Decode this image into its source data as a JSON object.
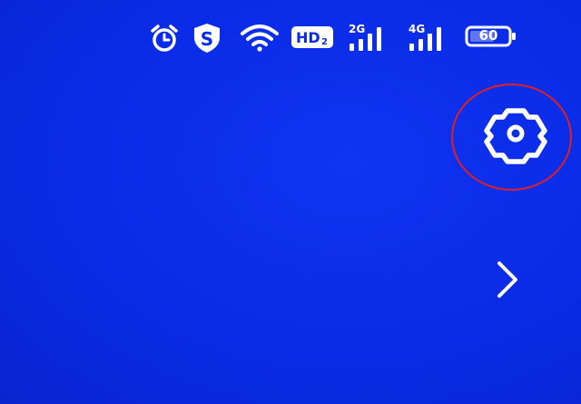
{
  "status_bar": {
    "icons": [
      "alarm-icon",
      "shield-s-icon",
      "wifi-icon",
      "hd-voice-icon",
      "signal-2g-icon",
      "signal-4g-icon",
      "battery-icon"
    ],
    "hd_label": "HD",
    "hd_sub": "2",
    "net1_label": "2G",
    "net2_label": "4G",
    "battery_level": "60"
  },
  "shield_letter": "S",
  "settings": {
    "icon": "gear-icon",
    "highlight_color": "#e02020"
  },
  "navigation": {
    "icon": "chevron-right-icon"
  },
  "colors": {
    "background": "#0a2be6",
    "foreground": "#ffffff",
    "highlight": "#e02020"
  }
}
